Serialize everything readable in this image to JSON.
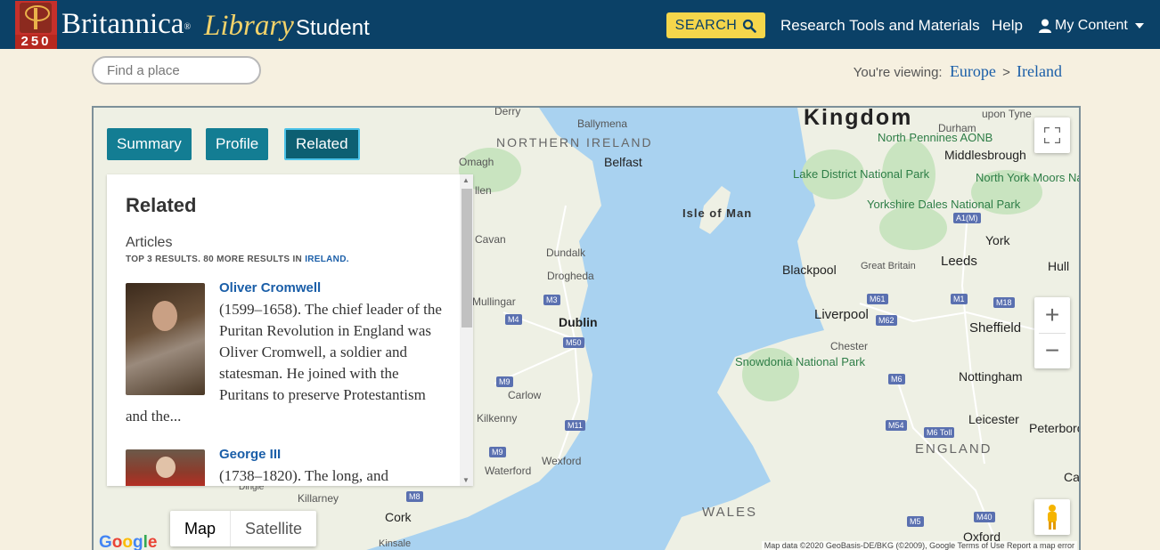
{
  "header": {
    "logo_number": "250",
    "brand": "Britannica",
    "brand_library": "Library",
    "brand_student": "Student",
    "search_label": "SEARCH",
    "nav": {
      "research": "Research Tools and Materials",
      "help": "Help",
      "my_content": "My Content"
    }
  },
  "subbar": {
    "find_place_placeholder": "Find a place",
    "viewing_label": "You're viewing:",
    "breadcrumb": [
      "Europe",
      "Ireland"
    ],
    "separator": ">"
  },
  "tabs": [
    {
      "label": "Summary"
    },
    {
      "label": "Profile"
    },
    {
      "label": "Related"
    }
  ],
  "panel": {
    "heading": "Related",
    "section": "Articles",
    "meta_prefix": "TOP 3 RESULTS. 80 MORE RESULTS IN",
    "meta_link": "IRELAND.",
    "articles": [
      {
        "title": "Oliver Cromwell",
        "desc": "(1599–1658). The chief leader of the Puritan Revolution in England was Oliver Cromwell, a soldier and statesman. He joined with the Puritans to preserve Protestantism and the..."
      },
      {
        "title": "George III",
        "desc": "(1738–1820). The long, and"
      }
    ]
  },
  "map": {
    "labels": {
      "kingdom": "Kingdom",
      "northern_ireland": "NORTHERN IRELAND",
      "england": "ENGLAND",
      "wales": "WALES",
      "isle_of_man": "Isle of Man",
      "north_pennines": "North Pennines AONB",
      "lake_district": "Lake District National Park",
      "yorkshire_dales": "Yorkshire Dales National Park",
      "north_york_moors": "North York Moors National Park",
      "snowdonia": "Snowdonia National Park",
      "derry": "Derry",
      "ballymena": "Ballymena",
      "belfast": "Belfast",
      "omagh": "Omagh",
      "allen": "llen",
      "cavan": "Cavan",
      "dundalk": "Dundalk",
      "drogheda": "Drogheda",
      "mullingar": "Mullingar",
      "dublin": "Dublin",
      "carlow": "Carlow",
      "kilkenny": "Kilkenny",
      "waterford": "Waterford",
      "wexford": "Wexford",
      "dingle": "Dingle",
      "killarney": "Killarney",
      "cork": "Cork",
      "kinsale": "Kinsale",
      "upon_tyne": "upon Tyne",
      "durham": "Durham",
      "middlesbrough": "Middlesbrough",
      "york": "York",
      "blackpool": "Blackpool",
      "great_britain": "Great Britain",
      "leeds": "Leeds",
      "hull": "Hull",
      "liverpool": "Liverpool",
      "sheffield": "Sheffield",
      "chester": "Chester",
      "nottingham": "Nottingham",
      "leicester": "Leicester",
      "peterborough": "Peterboro",
      "oxford": "Oxford",
      "ca": "Ca"
    },
    "shields": [
      "M3",
      "M4",
      "M50",
      "M9",
      "M11",
      "M9",
      "M8",
      "M61",
      "M62",
      "M1",
      "M18",
      "A1(M)",
      "M6",
      "M54",
      "M6 Toll",
      "M5",
      "M40"
    ],
    "maptype": {
      "map": "Map",
      "satellite": "Satellite"
    },
    "google": "Google",
    "attribution": "Map data ©2020 GeoBasis-DE/BKG (©2009), Google   Terms of Use   Report a map error",
    "colors": {
      "water": "#a9d2f0",
      "land": "#eef0e4",
      "park": "#c9e4c0"
    }
  }
}
